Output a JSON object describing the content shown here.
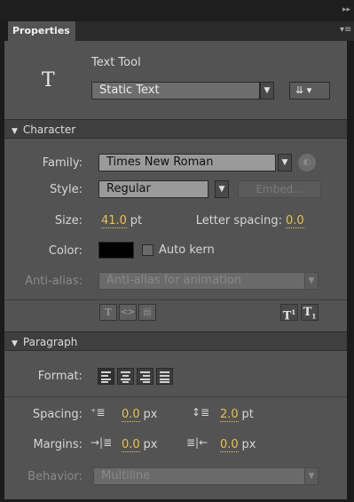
{
  "panel": {
    "tab_label": "Properties"
  },
  "tool": {
    "icon": "T",
    "name": "Text Tool",
    "text_type": "Static Text"
  },
  "character": {
    "header": "Character",
    "family_label": "Family:",
    "family_value": "Times New Roman",
    "style_label": "Style:",
    "style_value": "Regular",
    "embed_label": "Embed...",
    "size_label": "Size:",
    "size_value": "41.0",
    "size_unit": "pt",
    "letter_spacing_label": "Letter spacing:",
    "letter_spacing_value": "0.0",
    "color_label": "Color:",
    "color_swatch": "#000000",
    "auto_kern_label": "Auto kern",
    "auto_kern_checked": false,
    "anti_alias_label": "Anti-alias:",
    "anti_alias_value": "Anti-alias for animation"
  },
  "paragraph": {
    "header": "Paragraph",
    "format_label": "Format:",
    "spacing_label": "Spacing:",
    "indent_value": "0.0",
    "indent_unit": "px",
    "line_spacing_value": "2.0",
    "line_spacing_unit": "pt",
    "margins_label": "Margins:",
    "left_margin_value": "0.0",
    "left_margin_unit": "px",
    "right_margin_value": "0.0",
    "right_margin_unit": "px",
    "behavior_label": "Behavior:",
    "behavior_value": "Multiline"
  }
}
